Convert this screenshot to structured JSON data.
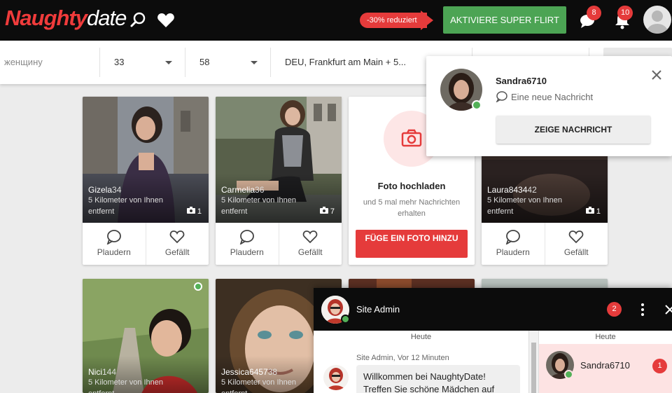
{
  "header": {
    "logo_part1": "Naughty",
    "logo_part2": "date",
    "discount_label": "-30% reduziert",
    "super_flirt_label": "AKTIVIERE SUPER FLIRT",
    "messages_count": "8",
    "notifications_count": "10",
    "icons": [
      "search-icon",
      "heart-icon",
      "chat-bubble-icon",
      "bell-icon",
      "user-avatar"
    ]
  },
  "filters": {
    "looking_for": "женщину",
    "age_from": "33",
    "age_to": "58",
    "location": "DEU, Frankfurt am Main + 5..."
  },
  "profiles": [
    {
      "name": "Gizela",
      "age": "34",
      "distance": "5 Kilometer von Ihnen entfernt",
      "photos": "1",
      "chat_label": "Plaudern",
      "like_label": "Gefällt"
    },
    {
      "name": "Carmelia",
      "age": "36",
      "distance": "5 Kilometer von Ihnen entfernt",
      "photos": "7",
      "chat_label": "Plaudern",
      "like_label": "Gefällt"
    },
    {
      "name": "Laura8434",
      "age": "42",
      "distance": "5 Kilometer von Ihnen entfernt",
      "photos": "1",
      "chat_label": "Plaudern",
      "like_label": "Gefällt"
    },
    {
      "name": "Nici",
      "age": "144",
      "distance": "5 Kilometer von Ihnen entfernt",
      "photos": "",
      "chat_label": "",
      "like_label": ""
    },
    {
      "name": "Jessica6457",
      "age": "38",
      "distance": "5 Kilometer von Ihnen entfernt",
      "photos": "",
      "chat_label": "",
      "like_label": ""
    }
  ],
  "upload": {
    "title": "Foto hochladen",
    "subtitle": "und 5 mal mehr Nachrichten erhalten",
    "button": "FÜGE EIN FOTO HINZU"
  },
  "notification": {
    "name": "Sandra6710",
    "message": "Eine neue Nachricht",
    "button": "ZEIGE NACHRICHT"
  },
  "chat": {
    "title": "Site Admin",
    "unread": "2",
    "day_left": "Heute",
    "day_right": "Heute",
    "message_meta": "Site Admin, Vor 12 Minuten",
    "message_text": "Willkommen bei NaughtyDate! Treffen Sie schöne Mädchen auf",
    "conversation_name": "Sandra6710",
    "conversation_unread": "1"
  },
  "colors": {
    "brand_red": "#e53b3b",
    "super_flirt_green": "#4ca454",
    "online_green": "#53b158",
    "topbar_black": "#0c0c0c"
  }
}
